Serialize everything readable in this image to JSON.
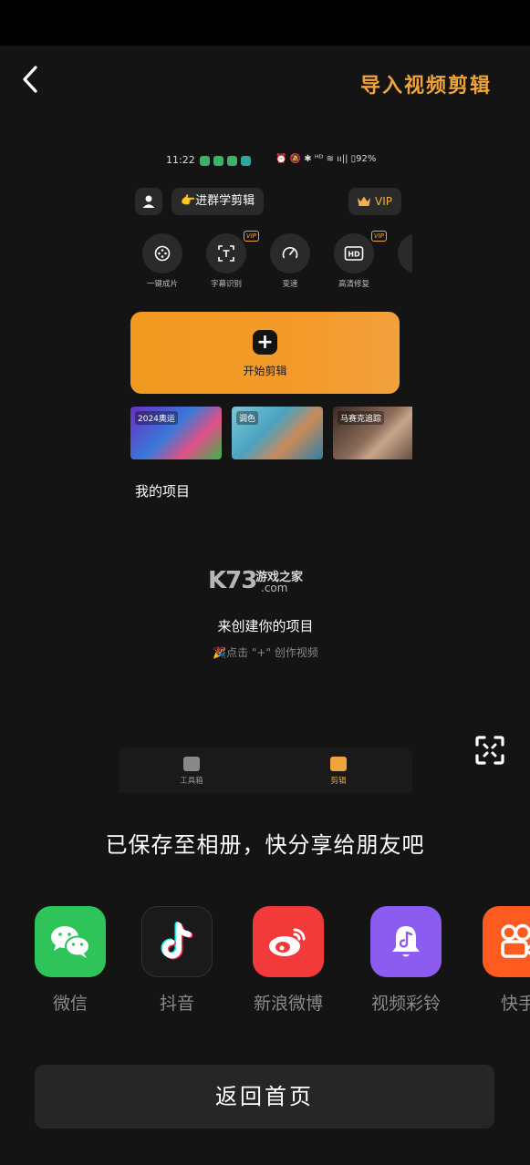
{
  "header": {
    "back_label": "",
    "import_label": "导入视频剪辑"
  },
  "preview": {
    "status_time": "11:22",
    "status_right": "⏰ 🔕 ✱ ᴴᴰ ≋ ıı|| ▯92%",
    "group_label": "👉进群学剪辑",
    "vip_label": "VIP",
    "tools": [
      {
        "label": "一键成片",
        "icon": "one-click-icon",
        "vip": false
      },
      {
        "label": "字幕识别",
        "icon": "subtitle-icon",
        "vip": true
      },
      {
        "label": "变速",
        "icon": "speed-icon",
        "vip": false
      },
      {
        "label": "高清修复",
        "icon": "hd-icon",
        "vip": true
      }
    ],
    "vip_badge": "VIP",
    "start_label": "开始剪辑",
    "thumbs": [
      {
        "label": "2024奥运"
      },
      {
        "label": "调色"
      },
      {
        "label": "马赛克追踪"
      }
    ],
    "projects_title": "我的项目",
    "watermark": {
      "k": "K73",
      "text": "游戏之家",
      "com": ".com"
    },
    "create_text": "来创建你的项目",
    "create_hint": "🎉点击 \"+\" 创作视频",
    "tabs": [
      {
        "label": "工具箱"
      },
      {
        "label": "剪辑"
      }
    ]
  },
  "saved_text": "已保存至相册，快分享给朋友吧",
  "share": [
    {
      "label": "微信",
      "icon": "wechat-icon",
      "color": "#2ec45a"
    },
    {
      "label": "抖音",
      "icon": "douyin-icon",
      "color": "#1a1a1a"
    },
    {
      "label": "新浪微博",
      "icon": "weibo-icon",
      "color": "#f23a3a"
    },
    {
      "label": "视频彩铃",
      "icon": "ringtone-icon",
      "color": "#8c5cf0"
    },
    {
      "label": "快手",
      "icon": "kuaishou-icon",
      "color": "#ff5a1f"
    }
  ],
  "home_button": "返回首页",
  "colors": {
    "accent": "#f0a33a",
    "background": "#141414"
  }
}
